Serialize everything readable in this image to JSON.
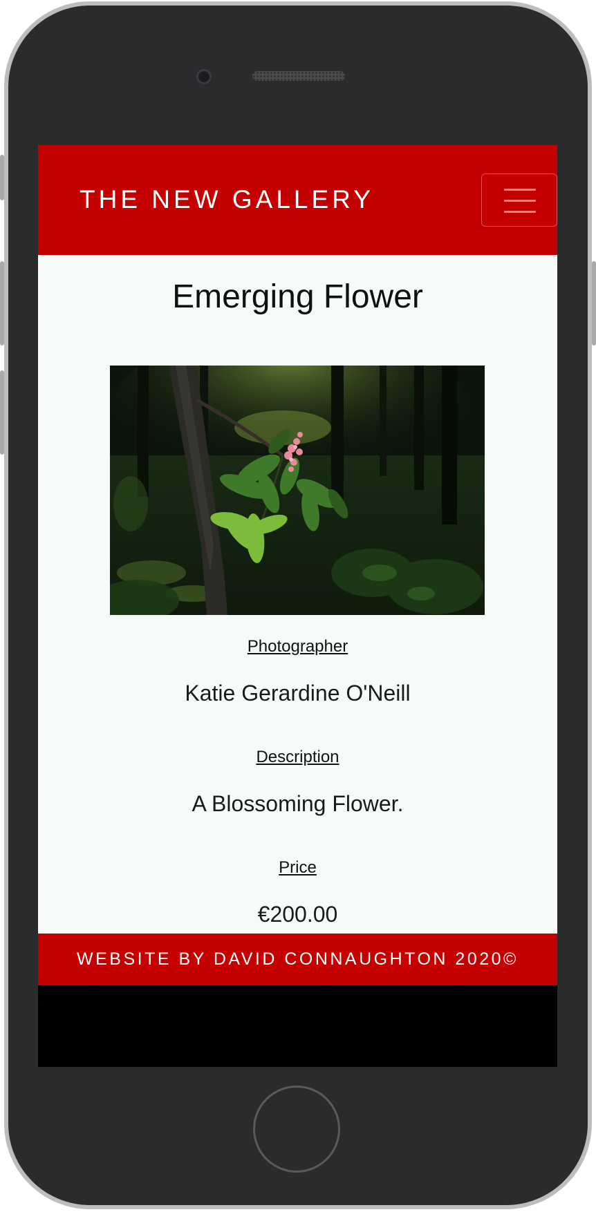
{
  "navbar": {
    "brand": "THE NEW GALLERY",
    "menu_icon": "hamburger-menu-icon"
  },
  "artwork": {
    "title": "Emerging Flower",
    "image_alt": "Photograph of a pink flower blossoming on a leafy branch in a dark forest",
    "photographer_label": "Photographer",
    "photographer": "Katie Gerardine O'Neill",
    "description_label": "Description",
    "description": "A Blossoming Flower.",
    "price_label": "Price",
    "price": "€200.00"
  },
  "footer": {
    "text": "WEBSITE BY DAVID CONNAUGHTON 2020©"
  },
  "colors": {
    "brand_red": "#c40000",
    "content_background": "#f6fbf8",
    "device_body": "#2b2b2d"
  }
}
